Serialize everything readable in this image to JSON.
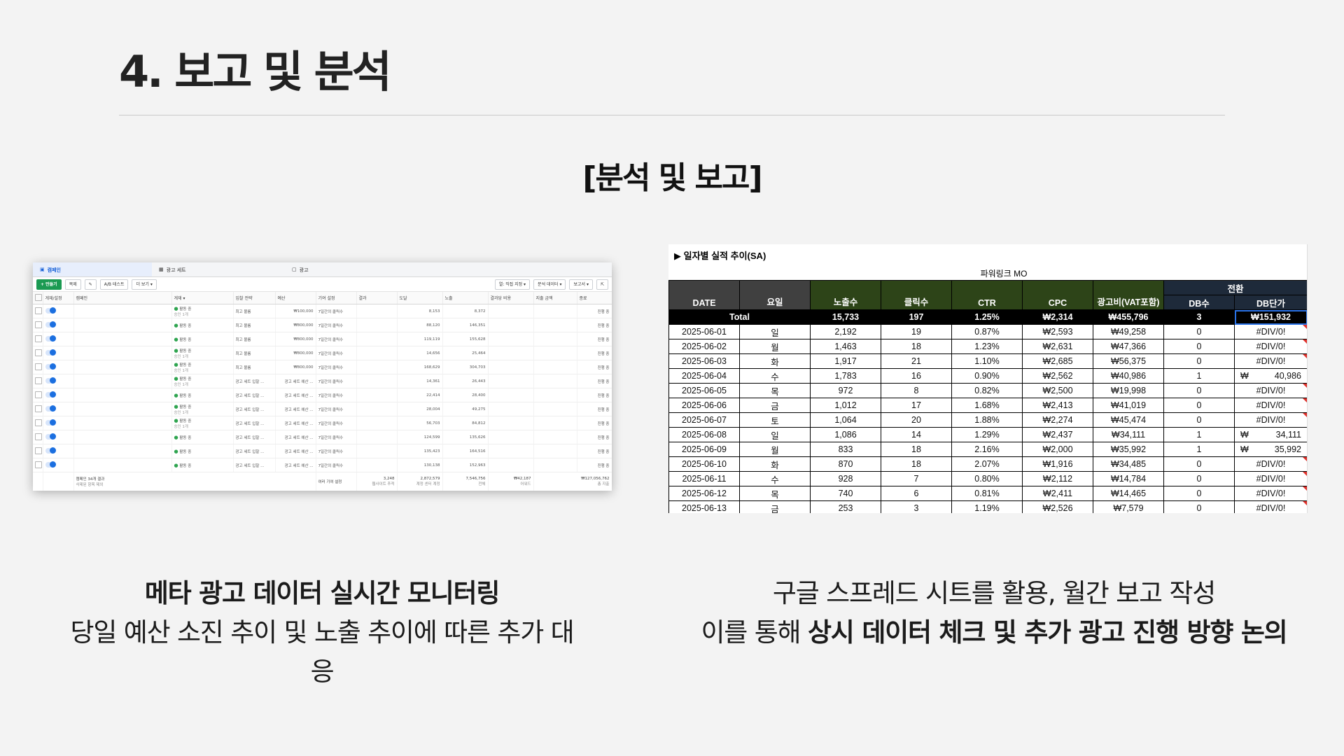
{
  "page": {
    "title": "4. 보고 및 분석",
    "section_heading": "[분석 및 보고]"
  },
  "meta_shot": {
    "tabs": [
      "캠페인",
      "광고 세트",
      "광고"
    ],
    "toolbar": {
      "create": "+ 만들기",
      "duplicate": "복제",
      "ab_test": "A/B 테스트",
      "more": "더 보기 ▾",
      "columns": "열: 직접 지정 ▾",
      "breakdown": "분석 데이터 ▾",
      "reports": "보고서 ▾"
    },
    "headers": [
      "",
      "게재/설정",
      "캠페인",
      "게재 ▾",
      "입찰 전략",
      "예산",
      "기여 설정",
      "결과",
      "도달",
      "노출",
      "결과당 비용",
      "지출 금액",
      "종료"
    ],
    "rows": [
      {
        "status": "활동 중",
        "sub": "승인 1개",
        "bid": "최고 볼륨",
        "budget": "₩100,000",
        "attr": "7일간의 클릭수",
        "reach": "8,153",
        "impr": "8,372",
        "end": "진행 중"
      },
      {
        "status": "활동 중",
        "sub": "",
        "bid": "최고 볼륨",
        "budget": "₩800,000",
        "attr": "7일간의 클릭수",
        "reach": "88,120",
        "impr": "146,351",
        "end": "진행 중"
      },
      {
        "status": "활동 중",
        "sub": "",
        "bid": "최고 볼륨",
        "budget": "₩800,000",
        "attr": "7일간의 클릭수",
        "reach": "119,119",
        "impr": "155,628",
        "end": "진행 중"
      },
      {
        "status": "활동 중",
        "sub": "승인 1개",
        "bid": "최고 볼륨",
        "budget": "₩800,000",
        "attr": "7일간의 클릭수",
        "reach": "14,656",
        "impr": "25,464",
        "end": "진행 중"
      },
      {
        "status": "활동 중",
        "sub": "승인 1개",
        "bid": "최고 볼륨",
        "budget": "₩800,000",
        "attr": "7일간의 클릭수",
        "reach": "168,629",
        "impr": "304,703",
        "end": "진행 중"
      },
      {
        "status": "활동 중",
        "sub": "승인 1개",
        "bid": "광고 세트 입찰 ...",
        "budget": "광고 세트 예산 ...",
        "attr": "7일간의 클릭수",
        "reach": "14,361",
        "impr": "26,443",
        "end": "진행 중"
      },
      {
        "status": "활동 중",
        "sub": "",
        "bid": "광고 세트 입찰 ...",
        "budget": "광고 세트 예산 ...",
        "attr": "7일간의 클릭수",
        "reach": "22,414",
        "impr": "28,400",
        "end": "진행 중"
      },
      {
        "status": "활동 중",
        "sub": "승인 1개",
        "bid": "광고 세트 입찰 ...",
        "budget": "광고 세트 예산 ...",
        "attr": "7일간의 클릭수",
        "reach": "28,004",
        "impr": "49,275",
        "end": "진행 중"
      },
      {
        "status": "활동 중",
        "sub": "승인 1개",
        "bid": "광고 세트 입찰 ...",
        "budget": "광고 세트 예산 ...",
        "attr": "7일간의 클릭수",
        "reach": "56,703",
        "impr": "84,812",
        "end": "진행 중"
      },
      {
        "status": "활동 중",
        "sub": "",
        "bid": "광고 세트 입찰 ...",
        "budget": "광고 세트 예산 ...",
        "attr": "7일간의 클릭수",
        "reach": "124,599",
        "impr": "135,626",
        "end": "진행 중"
      },
      {
        "status": "활동 중",
        "sub": "",
        "bid": "광고 세트 입찰 ...",
        "budget": "광고 세트 예산 ...",
        "attr": "7일간의 클릭수",
        "reach": "135,423",
        "impr": "164,516",
        "end": "진행 중"
      },
      {
        "status": "활동 중",
        "sub": "",
        "bid": "광고 세트 입찰 ...",
        "budget": "광고 세트 예산 ...",
        "attr": "7일간의 클릭수",
        "reach": "130,138",
        "impr": "152,963",
        "end": "진행 중"
      }
    ],
    "footer": {
      "label": "캠페인 34개 결과",
      "sublabel": "삭제된 항목 제외",
      "attr": "여러 기여 설정",
      "results": "3,248",
      "results_sub": "웹사이트 추적",
      "reach": "2,872,579",
      "reach_sub": "계정 센터 계정",
      "impr": "7,546,756",
      "impr_sub": "전체",
      "cpr": "₩42,187",
      "cpr_sub": "어워드",
      "spend": "₩127,056,762",
      "spend_sub": "총 지출"
    }
  },
  "sheet": {
    "title": "▶ 일자별 실적 추이(SA)",
    "subtitle": "파워링크 MO",
    "group_header": "전환",
    "headers": [
      "DATE",
      "요일",
      "노출수",
      "클릭수",
      "CTR",
      "CPC",
      "광고비(VAT포함)",
      "DB수",
      "DB단가"
    ],
    "total": {
      "label": "Total",
      "impr": "15,733",
      "clicks": "197",
      "ctr": "1.25%",
      "cpc": "₩2,314",
      "cost": "₩455,796",
      "db": "3",
      "db_cost": "₩151,932"
    },
    "rows": [
      {
        "date": "2025-06-01",
        "day": "일",
        "impr": "2,192",
        "clicks": "19",
        "ctr": "0.87%",
        "cpc": "₩2,593",
        "cost": "₩49,258",
        "db": "0",
        "db_cost": "#DIV/0!"
      },
      {
        "date": "2025-06-02",
        "day": "월",
        "impr": "1,463",
        "clicks": "18",
        "ctr": "1.23%",
        "cpc": "₩2,631",
        "cost": "₩47,366",
        "db": "0",
        "db_cost": "#DIV/0!"
      },
      {
        "date": "2025-06-03",
        "day": "화",
        "impr": "1,917",
        "clicks": "21",
        "ctr": "1.10%",
        "cpc": "₩2,685",
        "cost": "₩56,375",
        "db": "0",
        "db_cost": "#DIV/0!"
      },
      {
        "date": "2025-06-04",
        "day": "수",
        "impr": "1,783",
        "clicks": "16",
        "ctr": "0.90%",
        "cpc": "₩2,562",
        "cost": "₩40,986",
        "db": "1",
        "db_cost_sym": "₩",
        "db_cost": "40,986"
      },
      {
        "date": "2025-06-05",
        "day": "목",
        "impr": "972",
        "clicks": "8",
        "ctr": "0.82%",
        "cpc": "₩2,500",
        "cost": "₩19,998",
        "db": "0",
        "db_cost": "#DIV/0!"
      },
      {
        "date": "2025-06-06",
        "day": "금",
        "impr": "1,012",
        "clicks": "17",
        "ctr": "1.68%",
        "cpc": "₩2,413",
        "cost": "₩41,019",
        "db": "0",
        "db_cost": "#DIV/0!"
      },
      {
        "date": "2025-06-07",
        "day": "토",
        "impr": "1,064",
        "clicks": "20",
        "ctr": "1.88%",
        "cpc": "₩2,274",
        "cost": "₩45,474",
        "db": "0",
        "db_cost": "#DIV/0!"
      },
      {
        "date": "2025-06-08",
        "day": "일",
        "impr": "1,086",
        "clicks": "14",
        "ctr": "1.29%",
        "cpc": "₩2,437",
        "cost": "₩34,111",
        "db": "1",
        "db_cost_sym": "₩",
        "db_cost": "34,111"
      },
      {
        "date": "2025-06-09",
        "day": "월",
        "impr": "833",
        "clicks": "18",
        "ctr": "2.16%",
        "cpc": "₩2,000",
        "cost": "₩35,992",
        "db": "1",
        "db_cost_sym": "₩",
        "db_cost": "35,992"
      },
      {
        "date": "2025-06-10",
        "day": "화",
        "impr": "870",
        "clicks": "18",
        "ctr": "2.07%",
        "cpc": "₩1,916",
        "cost": "₩34,485",
        "db": "0",
        "db_cost": "#DIV/0!"
      },
      {
        "date": "2025-06-11",
        "day": "수",
        "impr": "928",
        "clicks": "7",
        "ctr": "0.80%",
        "cpc": "₩2,112",
        "cost": "₩14,784",
        "db": "0",
        "db_cost": "#DIV/0!"
      },
      {
        "date": "2025-06-12",
        "day": "목",
        "impr": "740",
        "clicks": "6",
        "ctr": "0.81%",
        "cpc": "₩2,411",
        "cost": "₩14,465",
        "db": "0",
        "db_cost": "#DIV/0!"
      },
      {
        "date": "2025-06-13",
        "day": "금",
        "impr": "253",
        "clicks": "3",
        "ctr": "1.19%",
        "cpc": "₩2,526",
        "cost": "₩7,579",
        "db": "0",
        "db_cost": "#DIV/0!"
      }
    ]
  },
  "captions": {
    "left_line1": "메타 광고 데이터 실시간 모니터링",
    "left_line2": "당일 예산 소진 추이 및 노출 추이에 따른 추가 대응",
    "right_line1": "구글 스프레드 시트를 활용, 월간 보고 작성",
    "right_line2_prefix": "이를 통해 ",
    "right_line2_bold": "상시 데이터 체크 및 추가 광고 진행 방향 논의"
  },
  "colors": {
    "background": "#f3f3f3",
    "sheet_header_dark": "#404040",
    "sheet_header_olive": "#2d4418",
    "sheet_header_navy": "#1e2a3a",
    "meta_accent": "#1b6fe0",
    "meta_create": "#1b9a52"
  }
}
